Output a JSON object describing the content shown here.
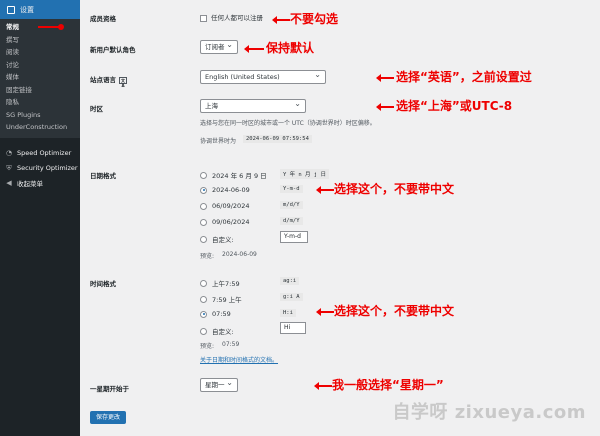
{
  "sidebar": {
    "header": "设置",
    "sub_items": [
      "常规",
      "撰写",
      "阅读",
      "讨论",
      "媒体",
      "固定链接",
      "隐私",
      "SG Plugins",
      "UnderConstruction"
    ],
    "items": [
      {
        "label": "Speed Optimizer",
        "icon": "speed-icon"
      },
      {
        "label": "Security Optimizer",
        "icon": "shield-icon"
      },
      {
        "label": "收起菜单",
        "icon": "collapse-icon"
      }
    ]
  },
  "settings": {
    "membership": {
      "label": "成员资格",
      "checkbox_label": "任何人都可以注册"
    },
    "default_role": {
      "label": "新用户默认角色",
      "value": "订阅者"
    },
    "site_language": {
      "label": "站点语言",
      "value": "English (United States)"
    },
    "timezone": {
      "label": "时区",
      "value": "上海",
      "help": "选择与您在同一时区的城市或一个 UTC（协调世界时）时区偏移。",
      "utc_label": "协调世界时为",
      "utc_value": "2024-06-09 07:59:54"
    },
    "date_format": {
      "label": "日期格式",
      "options": [
        {
          "label": "2024 年 6 月 9 日",
          "code": "Y 年 n 月 j 日",
          "selected": false
        },
        {
          "label": "2024-06-09",
          "code": "Y-m-d",
          "selected": true
        },
        {
          "label": "06/09/2024",
          "code": "m/d/Y",
          "selected": false
        },
        {
          "label": "09/06/2024",
          "code": "d/m/Y",
          "selected": false
        }
      ],
      "custom_label": "自定义:",
      "custom_value": "Y-m-d",
      "preview_label": "预览:",
      "preview_value": "2024-06-09"
    },
    "time_format": {
      "label": "时间格式",
      "options": [
        {
          "label": "上午7:59",
          "code": "ag:i",
          "selected": false
        },
        {
          "label": "7:59 上午",
          "code": "g:i A",
          "selected": false
        },
        {
          "label": "07:59",
          "code": "H:i",
          "selected": true
        }
      ],
      "custom_label": "自定义:",
      "custom_value": "Hi",
      "preview_label": "预览:",
      "preview_value": "07:59",
      "doc_link": "关于日期和时间格式的文档。"
    },
    "week_start": {
      "label": "一星期开始于",
      "value": "星期一"
    },
    "save_button": "保存更改"
  },
  "annotations": {
    "a1": "不要勾选",
    "a2": "保持默认",
    "a3": "选择“英语”，之前设置过",
    "a4": "选择“上海”或UTC-8",
    "a5": "选择这个，不要带中文",
    "a6": "选择这个，不要带中文",
    "a7": "我一般选择“星期一”"
  },
  "watermark": "自学呀 zixueya.com"
}
